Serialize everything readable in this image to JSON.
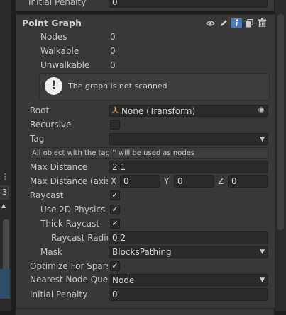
{
  "top_fragment": {
    "label": "Initial Penalty",
    "value": "0"
  },
  "header": {
    "title": "Point Graph"
  },
  "stats": [
    {
      "label": "Nodes",
      "value": "0"
    },
    {
      "label": "Walkable",
      "value": "0"
    },
    {
      "label": "Unwalkable",
      "value": "0"
    }
  ],
  "info_message": "The graph is not scanned",
  "root": {
    "label": "Root",
    "value": "None (Transform)"
  },
  "recursive": {
    "label": "Recursive",
    "checked": false
  },
  "tag": {
    "label": "Tag",
    "value": ""
  },
  "tag_note": "All object with the tag '' will be used as nodes",
  "max_distance": {
    "label": "Max Distance",
    "value": "2.1"
  },
  "max_distance_axis": {
    "label": "Max Distance (axis",
    "x_label": "X",
    "x": "0",
    "y_label": "Y",
    "y": "0",
    "z_label": "Z",
    "z": "0"
  },
  "raycast": {
    "label": "Raycast",
    "checked": true
  },
  "use_2d_physics": {
    "label": "Use 2D Physics",
    "checked": true
  },
  "thick_raycast": {
    "label": "Thick Raycast",
    "checked": true
  },
  "raycast_radius": {
    "label": "Raycast Radiu",
    "value": "0.2"
  },
  "mask": {
    "label": "Mask",
    "value": "BlocksPathing"
  },
  "optimize_sparse": {
    "label": "Optimize For Sparse",
    "checked": true
  },
  "nearest_node": {
    "label": "Nearest Node Quer",
    "value": "Node"
  },
  "initial_penalty": {
    "label": "Initial Penalty",
    "value": "0"
  },
  "left_panel": {
    "badge": "3",
    "dots": "⋮",
    "arrow": "▲"
  },
  "glyphs": {
    "check": "✓",
    "dropdown": "▼",
    "target": "◉",
    "warning": "!"
  },
  "icons": [
    "eye-icon",
    "pencil-icon",
    "info-icon",
    "copy-icon",
    "trash-icon"
  ]
}
